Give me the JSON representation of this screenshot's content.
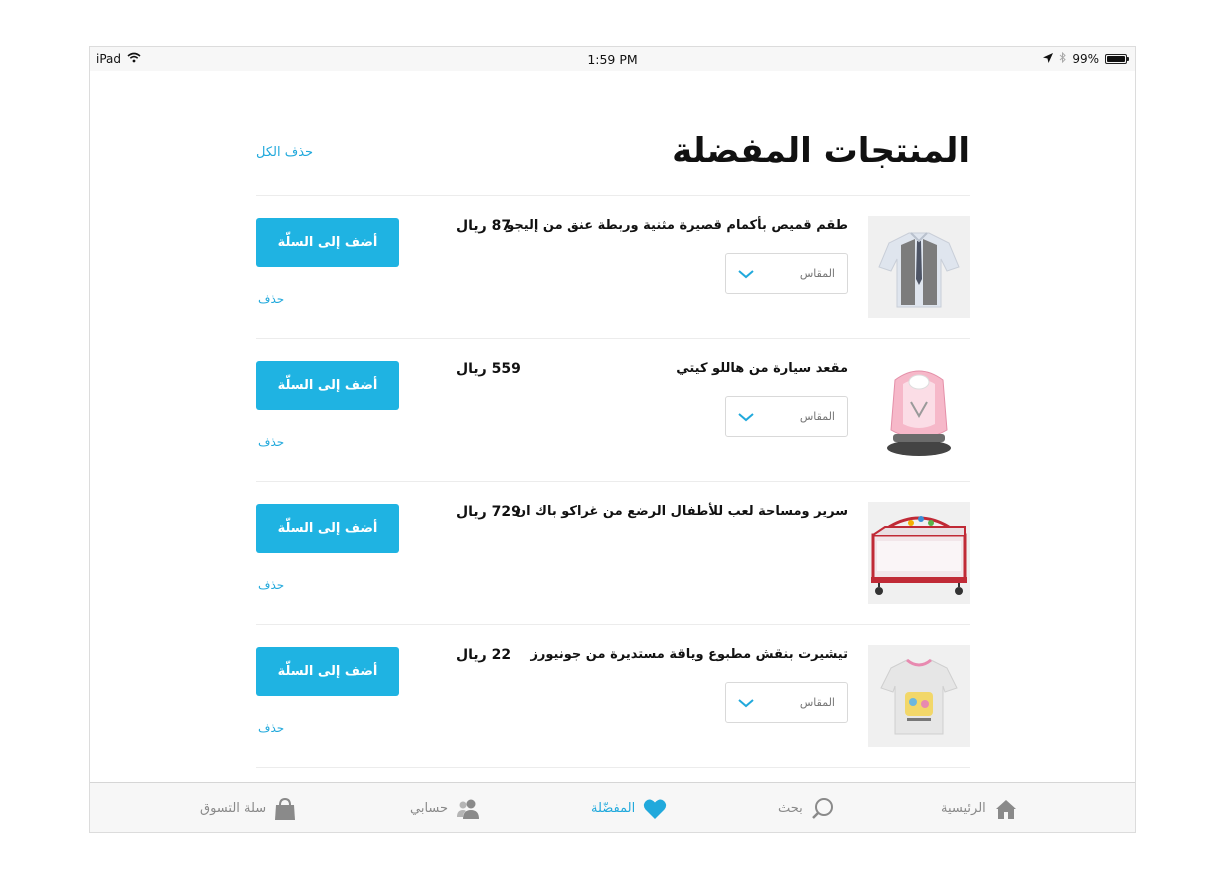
{
  "status_bar": {
    "device": "iPad",
    "time": "1:59 PM",
    "battery": "99%",
    "battery_level": 0.99
  },
  "page": {
    "title": "المنتجات المفضلة",
    "clear_all": "حذف الكل"
  },
  "items": [
    {
      "name": "طقم قميص بأكمام قصيرة مثنية وربطة عنق من إليجو",
      "price": "87 ريال",
      "size_placeholder": "المقاس",
      "add_to_cart": "أضف إلى السلّة",
      "remove": "حذف",
      "image": "shirt-vest-set-image",
      "has_size": true
    },
    {
      "name": "مقعد سيارة من هاللو كيتي",
      "price": "559 ريال",
      "size_placeholder": "المقاس",
      "add_to_cart": "أضف إلى السلّة",
      "remove": "حذف",
      "image": "car-seat-image",
      "has_size": true
    },
    {
      "name": "سرير ومساحة لعب للأطفال الرضع من غراكو باك ان",
      "price": "729 ريال",
      "size_placeholder": "",
      "add_to_cart": "أضف إلى السلّة",
      "remove": "حذف",
      "image": "playard-crib-image",
      "has_size": false
    },
    {
      "name": "تيشيرت بنقش مطبوع وياقة مستديرة من جونيورز",
      "price": "22 ريال",
      "size_placeholder": "المقاس",
      "add_to_cart": "أضف إلى السلّة",
      "remove": "حذف",
      "image": "tshirt-image",
      "has_size": true
    }
  ],
  "tabbar": {
    "home": "الرئيسية",
    "search": "بحث",
    "favorites": "المفضّلة",
    "account": "حسابي",
    "cart": "سلة التسوق"
  },
  "colors": {
    "accent": "#1fb3e2",
    "link": "#21a9dc",
    "text": "#111111",
    "muted": "#8a8a8a"
  }
}
